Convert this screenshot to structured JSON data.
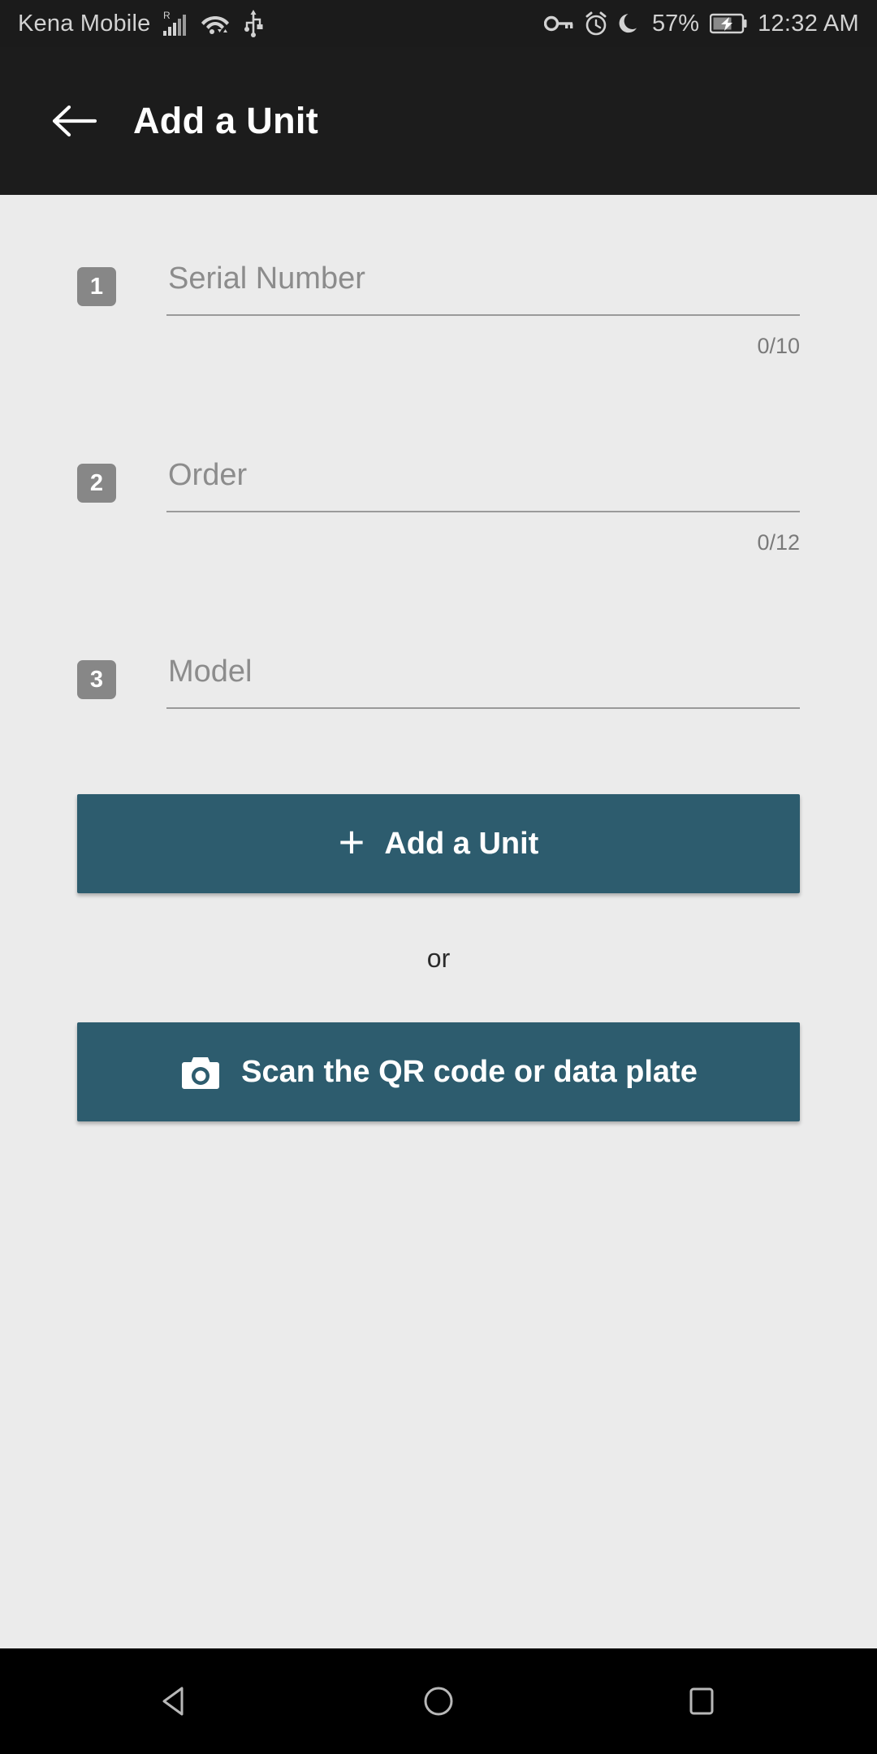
{
  "status_bar": {
    "carrier": "Kena Mobile",
    "battery_percent": "57%",
    "clock": "12:32 AM",
    "icons": {
      "signal": "cellular-signal-roaming-icon",
      "wifi": "wifi-icon",
      "usb": "usb-icon",
      "vpn": "vpn-key-icon",
      "alarm": "alarm-icon",
      "dnd": "moon-do-not-disturb-icon",
      "battery": "battery-charging-icon"
    }
  },
  "appbar": {
    "title": "Add a Unit",
    "back_icon": "arrow-back-icon"
  },
  "form": {
    "fields": [
      {
        "badge": "1",
        "placeholder": "Serial Number",
        "value": "",
        "counter": "0/10"
      },
      {
        "badge": "2",
        "placeholder": "Order",
        "value": "",
        "counter": "0/12"
      },
      {
        "badge": "3",
        "placeholder": "Model",
        "value": "",
        "counter": ""
      }
    ]
  },
  "actions": {
    "add_unit_label": "Add a Unit",
    "add_unit_icon": "plus-icon",
    "separator": "or",
    "scan_label": "Scan the QR code or data plate",
    "scan_icon": "camera-icon"
  },
  "navbar": {
    "back": "nav-back-triangle-icon",
    "home": "nav-home-circle-icon",
    "recents": "nav-recents-square-icon"
  },
  "colors": {
    "accent": "#2d5c6e",
    "status_bar_bg": "#1b1b1b",
    "appbar_bg": "#1c1c1c",
    "content_bg": "#ebebeb",
    "badge_bg": "#878787",
    "navbar_bg": "#000000"
  }
}
